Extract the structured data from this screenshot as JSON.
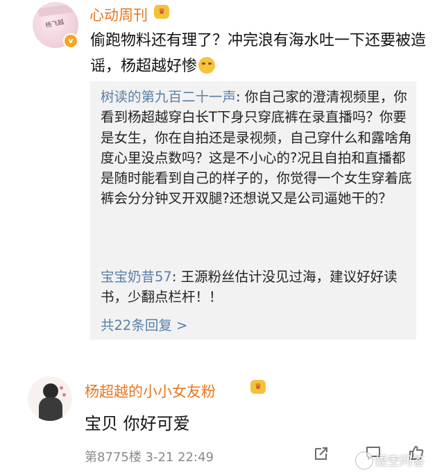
{
  "post": {
    "author": "心动周刊",
    "text": "偷跑物料还有理了？冲完浪有海水吐一下还要被造谣，杨超越好惨"
  },
  "replies": [
    {
      "user": "树读的第九百二十一声",
      "text": ": 你自己家的澄清视频里，你看到杨超越穿白长T下身只穿底裤在录直播吗？你要是女生，你在自拍还是录视频，自己穿什么和露啥角度心里没点数吗？这是不小心的?况且自拍和直播都是随时能看到自己的样子的，你觉得一个女生穿着底裤会分分钟叉开双腿?还想说又是公司逼她干的？"
    },
    {
      "user": "宝宝奶昔57",
      "text": ": 王源粉丝估计没见过海，建议好好读书，少翻点栏杆！！"
    }
  ],
  "more_replies": "共22条回复 >",
  "comment": {
    "author": "杨超越的小小女友粉",
    "text": "宝贝 你好可爱",
    "meta": "第8775楼 3-21 22:49"
  },
  "watermark": "悟空问答",
  "icons": {
    "verified": "verified-v-icon",
    "crown": "crown-badge-icon",
    "crying": "crying-face-emoji",
    "share": "share-icon",
    "comment": "comment-icon",
    "like": "like-icon"
  },
  "colors": {
    "username": "#e8761f",
    "reply_name": "#5b7fa8",
    "quote_bg": "#f2f2f2",
    "meta_gray": "#8a8a8a"
  }
}
